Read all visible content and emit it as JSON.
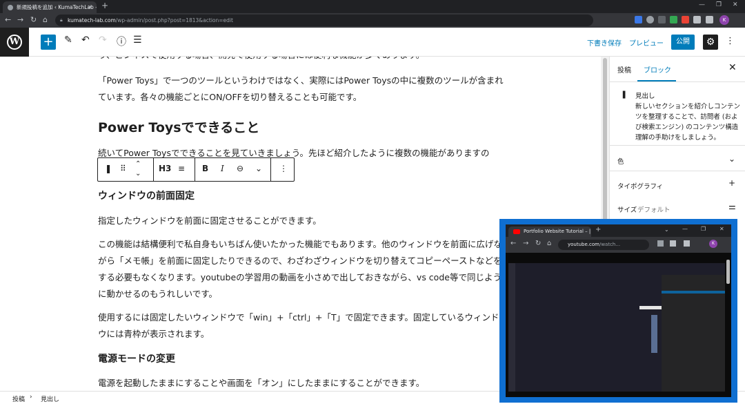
{
  "browser": {
    "tab_title": "新規投稿を追加 ‹ KumaTechLab —",
    "url_domain": "kumatech-lab.com",
    "url_path": "/wp-admin/post.php?post=1813&action=edit",
    "profile_initial": "K"
  },
  "toolbar": {
    "save_draft": "下書き保存",
    "preview": "プレビュー",
    "publish": "公開"
  },
  "content": {
    "para_top_cut": "り、ビジネスで使用する場合、開発で使用する場合には便利な機能が多くあります。",
    "para1": "「Power Toys」で一つのツールというわけではなく、実際にはPower Toysの中に複数のツールが含まれています。各々の機能ごとにON/OFFを切り替えることも可能です。",
    "heading_features": "Power Toysでできること",
    "para2": "続いてPower Toysでできることを見ていきましょう。先ほど紹介したように複数の機能がありますの",
    "heading_window": "ウィンドウの前面固定",
    "para3": "指定したウィンドウを前面に固定させることができます。",
    "para4": "この機能は結構便利で私自身もいちばん使いたかった機能でもあります。他のウィンドウを前面に広げながら「メモ帳」を前面に固定したりできるので、わざわざウィンドウを切り替えてコピーペーストなどをする必要もなくなります。youtubeの学習用の動画を小さめで出しておきながら、vs code等で同じように動かせるのもうれしいです。",
    "para5": "使用するには固定したいウィンドウで「win」+「ctrl」+「T」で固定できます。固定しているウィンドウには青枠が表示されます。",
    "heading_power": "電源モードの変更",
    "para6": "電源を起動したままにすることや画面を「オン」にしたままにすることができます。"
  },
  "block_toolbar": {
    "heading_level": "H3"
  },
  "sidebar": {
    "tab_post": "投稿",
    "tab_block": "ブロック",
    "block_name": "見出し",
    "block_desc": "新しいセクションを紹介しコンテンツを整理することで、訪問者 (および検索エンジン) のコンテンツ構造理解の手助けをしましょう。",
    "color_label": "色",
    "typography_label": "タイポグラフィ",
    "size_label": "サイズ",
    "size_value": "デフォルト"
  },
  "footer": {
    "crumb_root": "投稿",
    "crumb_current": "見出し"
  },
  "pip": {
    "tab_title": "Portfolio Website Tutorial – |",
    "url_domain": "youtube.com",
    "url_rest": "/watch...",
    "profile_initial": "K"
  }
}
